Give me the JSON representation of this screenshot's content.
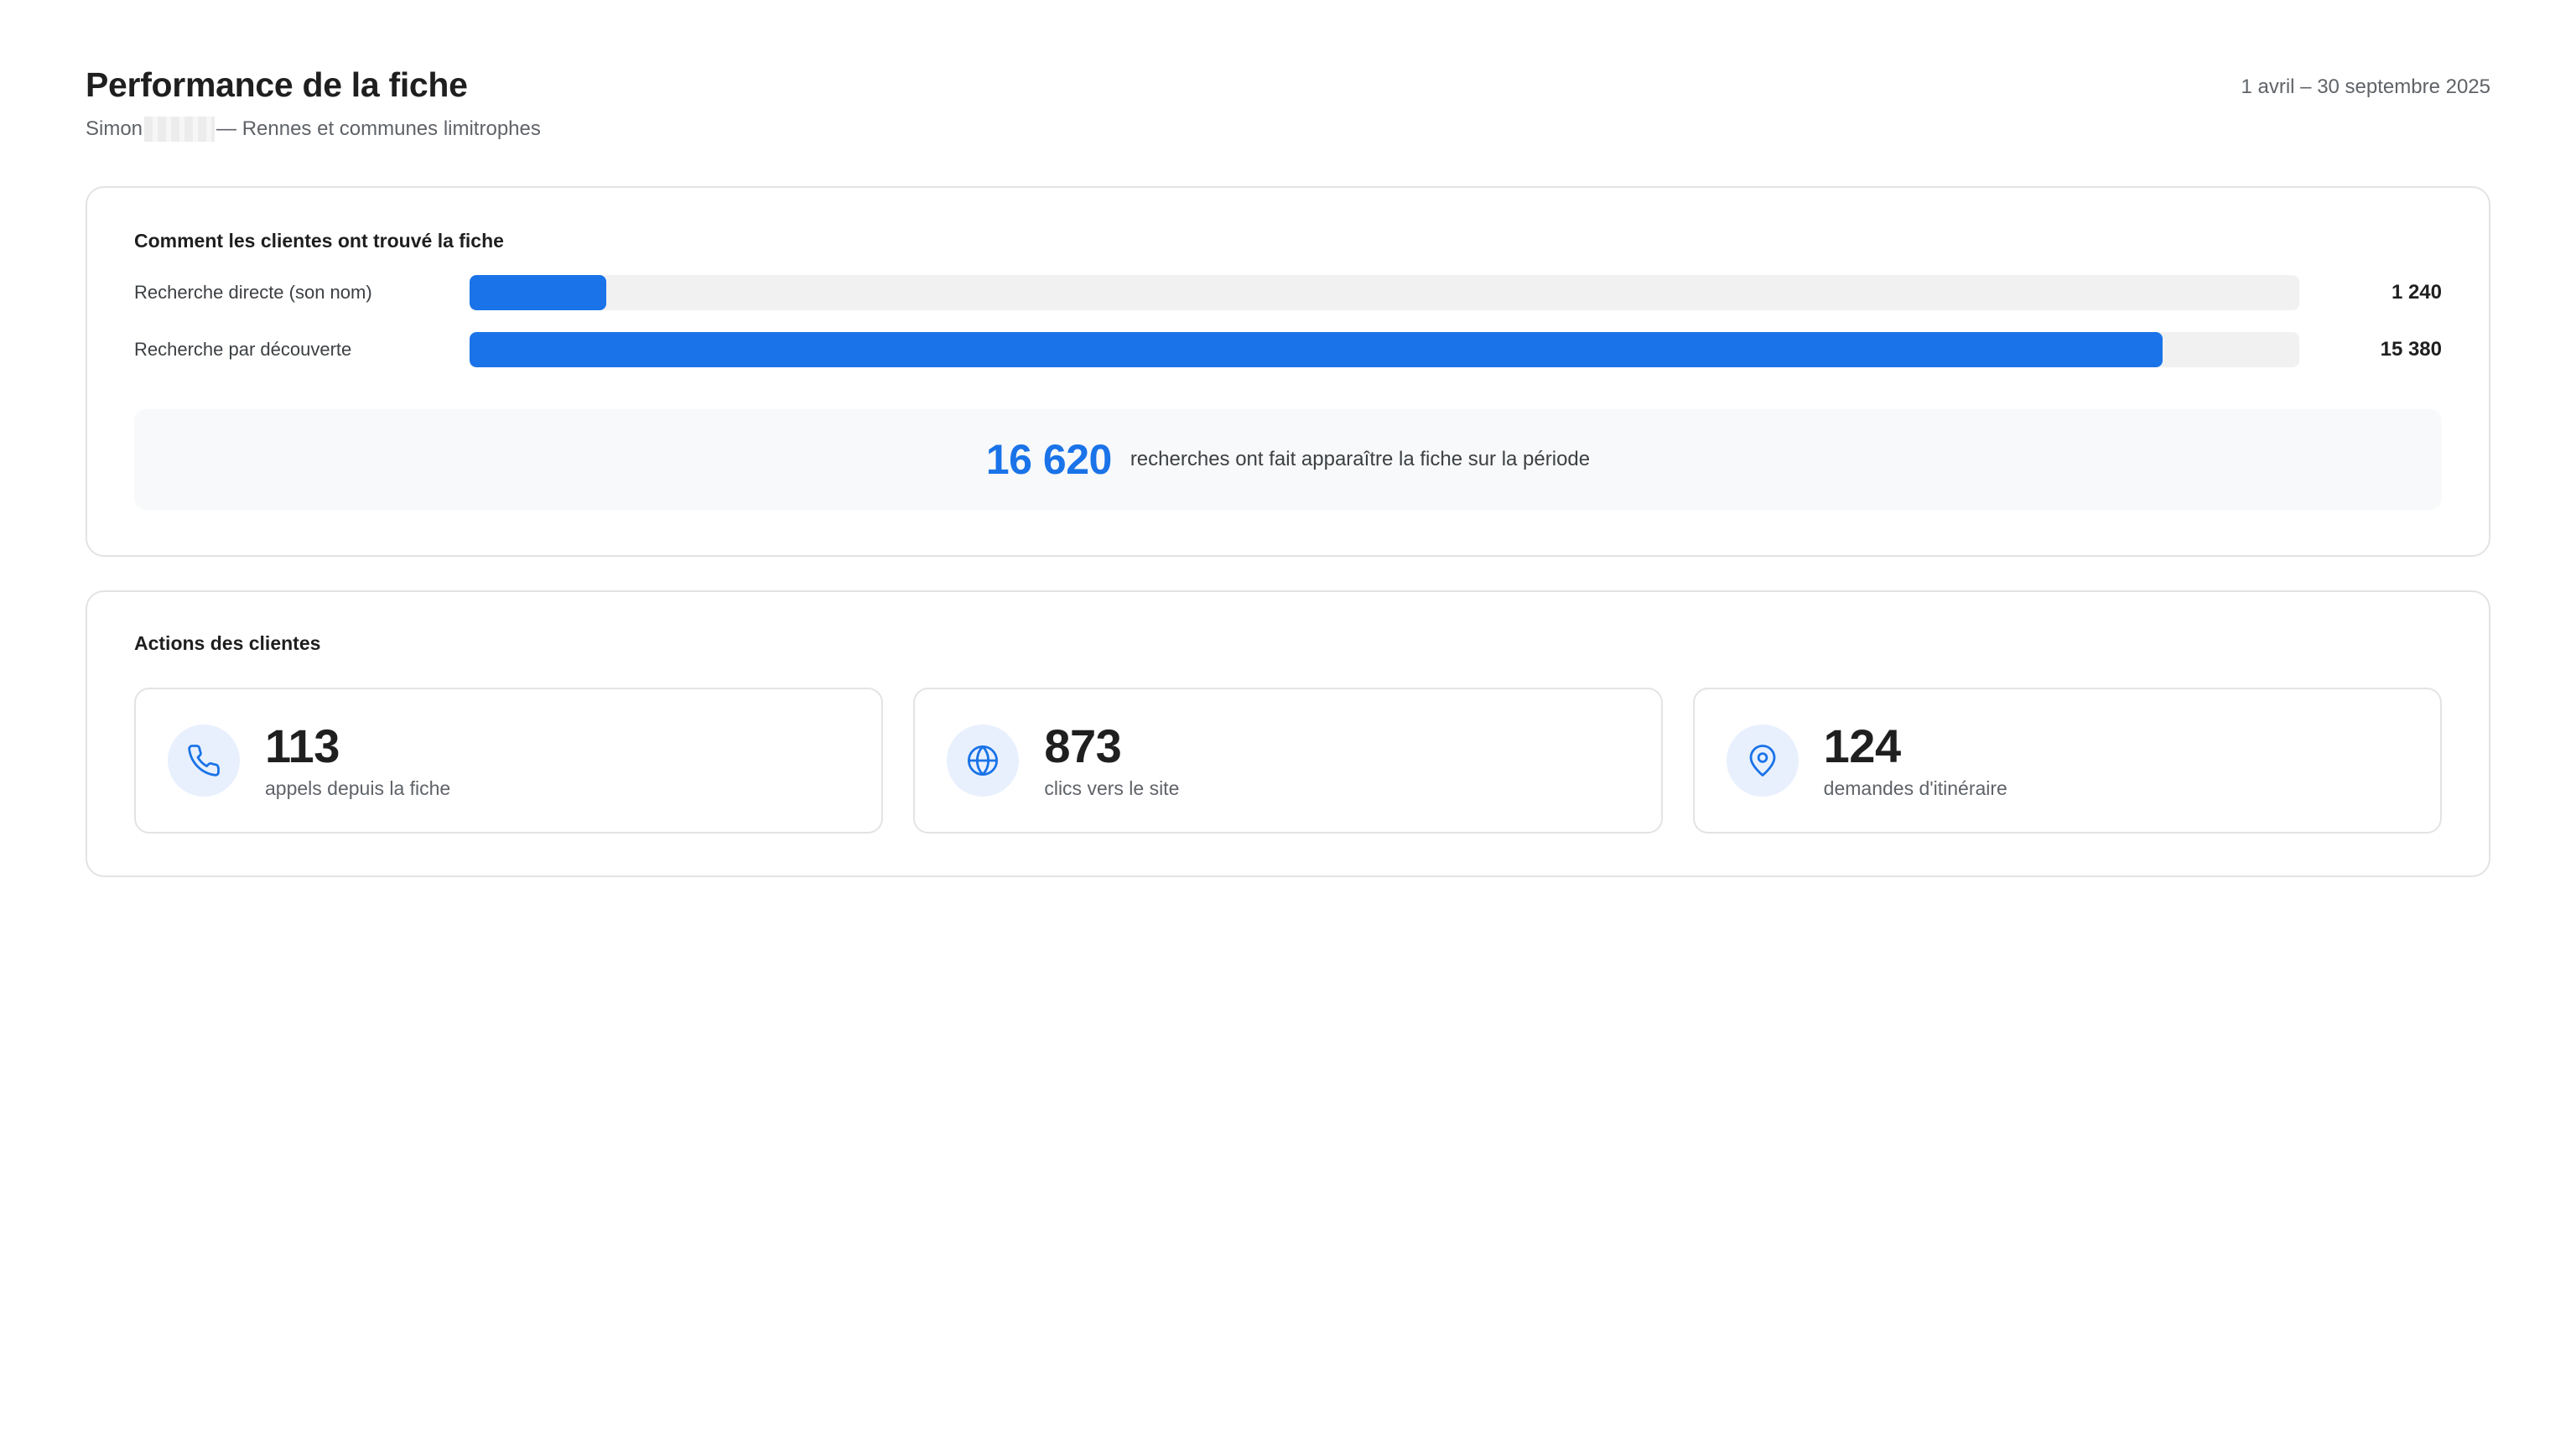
{
  "header": {
    "title": "Performance de la fiche",
    "subtitle_name": "Simon",
    "subtitle_rest": "— Rennes et communes limitrophes",
    "date_range": "1 avril – 30 septembre 2025"
  },
  "discovery": {
    "title": "Comment les clientes ont trouvé la fiche",
    "rows": [
      {
        "label": "Recherche directe (son nom)",
        "value": 1240,
        "value_text": "1 240"
      },
      {
        "label": "Recherche par découverte",
        "value": 15380,
        "value_text": "15 380"
      }
    ],
    "scale_max": 16620,
    "total_number": "16 620",
    "total_text": "recherches ont fait apparaître la fiche sur la période"
  },
  "actions": {
    "title": "Actions des clientes",
    "tiles": [
      {
        "icon": "phone-icon",
        "value": "113",
        "label": "appels depuis la fiche"
      },
      {
        "icon": "globe-icon",
        "value": "873",
        "label": "clics vers le site"
      },
      {
        "icon": "map-pin-icon",
        "value": "124",
        "label": "demandes d'itinéraire"
      }
    ]
  },
  "colors": {
    "accent": "#1a73e8",
    "track": "#f1f1f1",
    "icon_bg": "#e8f0fe"
  }
}
